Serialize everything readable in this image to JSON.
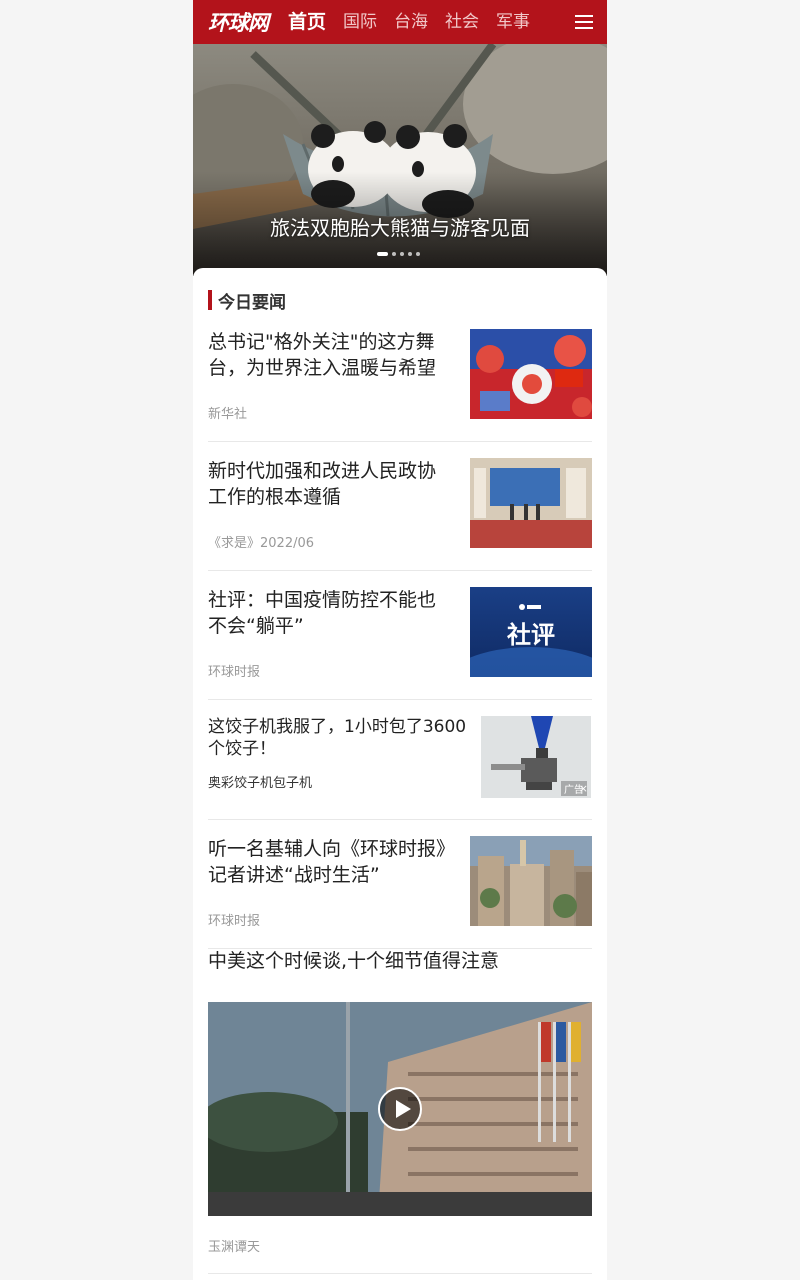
{
  "header": {
    "logo_text": "环球网",
    "nav": [
      "首页",
      "国际",
      "台海",
      "社会",
      "军事"
    ],
    "active_index": 0,
    "menu_icon": "hamburger-menu-icon",
    "brand_color": "#b3131b"
  },
  "hero": {
    "caption": "旅法双胞胎大熊猫与游客见面",
    "slide_count": 5,
    "active_slide": 0
  },
  "section": {
    "title": "今日要闻"
  },
  "news": [
    {
      "title": "总书记\"格外关注\"的这方舞台，为世界注入温暖与希望",
      "source": "新华社"
    },
    {
      "title": "新时代加强和改进人民政协工作的根本遵循",
      "source": "《求是》2022/06"
    },
    {
      "title": "社评：中国疫情防控不能也不会“躺平”",
      "source": "环球时报",
      "thumb_text": "社评"
    },
    {
      "title": "这饺子机我服了，1小时包了3600个饺子！",
      "source": "奥彩饺子机包子机",
      "ad_label": "广告",
      "ad_close": "×"
    },
    {
      "title": "听一名基辅人向《环球时报》记者讲述“战时生活”",
      "source": "环球时报"
    }
  ],
  "video": {
    "title": "中美这个时候谈,十个细节值得注意",
    "source": "玉渊谭天",
    "play_icon": "play-icon"
  }
}
